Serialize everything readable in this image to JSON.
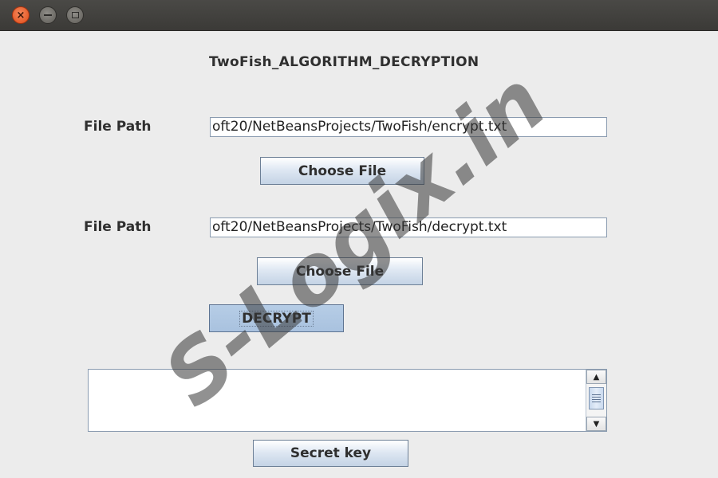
{
  "window": {
    "controls": {
      "close_icon": "close-icon",
      "minimize_icon": "minimize-icon",
      "maximize_icon": "maximize-icon"
    }
  },
  "heading": "TwoFish_ALGORITHM_DECRYPTION",
  "input_file": {
    "label": "File Path",
    "value": "oft20/NetBeansProjects/TwoFish/encrypt.txt",
    "button_label": "Choose File"
  },
  "output_file": {
    "label": "File Path",
    "value": "oft20/NetBeansProjects/TwoFish/decrypt.txt",
    "button_label": "Choose File"
  },
  "decrypt_button_label": "DECRYPT",
  "output_area": {
    "value": ""
  },
  "secret_key_button_label": "Secret key",
  "watermark": "S-Logix.in",
  "colors": {
    "close_button": "#df4a16",
    "button_face": "#dfe8f3",
    "pressed_button": "#b6cde6",
    "background": "#ececec"
  }
}
